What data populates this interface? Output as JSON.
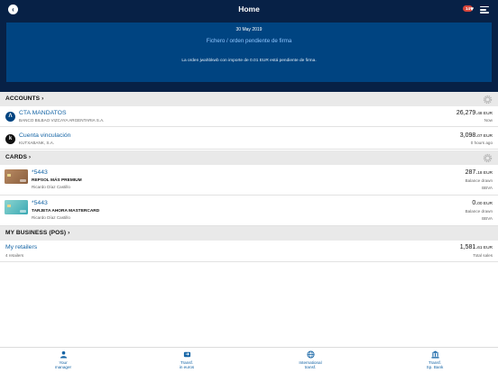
{
  "header": {
    "title": "Home",
    "notification_count": "14"
  },
  "banner": {
    "date": "30 May 2019",
    "link_text": "Fichero / orden pendiente de firma",
    "message": "La orden jwahbkwb con importe de 0.01 EUR está pendiente de firma."
  },
  "accounts": {
    "section_title": "ACCOUNTS ›",
    "items": [
      {
        "name": "CTA MANDATOS",
        "bank": "BANCO BILBAO VIZCAYA ARGENTARIA S.A.",
        "amount_main": "26,279.",
        "amount_dec": "48 EUR",
        "meta": "Now"
      },
      {
        "name": "Cuenta vinculación",
        "bank": "KUTXABANK, S.A.",
        "amount_main": "3,098.",
        "amount_dec": "07 EUR",
        "meta": "0 hours ago"
      }
    ]
  },
  "cards": {
    "section_title": "CARDS ›",
    "items": [
      {
        "number": "*5443",
        "product": "REPSOL MÁS PREMIUM",
        "holder": "Ricardo Díaz Castillo",
        "amount_main": "287.",
        "amount_dec": "18 EUR",
        "meta1": "Balance drawn",
        "meta2": "BBVA"
      },
      {
        "number": "*5443",
        "product": "TARJETA AHORA MASTERCARD",
        "holder": "Ricardo Díaz Castillo",
        "amount_main": "0.",
        "amount_dec": "00 EUR",
        "meta1": "Balance drawn",
        "meta2": "BBVA"
      }
    ]
  },
  "business": {
    "section_title": "MY BUSINESS (POS) ›",
    "item": {
      "name": "My retailers",
      "sub": "4 retailers",
      "amount_main": "1,581.",
      "amount_dec": "61 EUR",
      "meta": "Total sales"
    }
  },
  "tabs": [
    {
      "line1": "Your",
      "line2": "manager",
      "icon": "person-icon"
    },
    {
      "line1": "Transf.",
      "line2": "in euros",
      "icon": "transfer-icon"
    },
    {
      "line1": "International",
      "line2": "transf.",
      "icon": "globe-icon"
    },
    {
      "line1": "Transf.",
      "line2": "Sp. Bank",
      "icon": "bank-icon"
    }
  ],
  "colors": {
    "header": "#072146",
    "banner": "#004481",
    "link": "#1464a5",
    "badge": "#d8463b"
  }
}
